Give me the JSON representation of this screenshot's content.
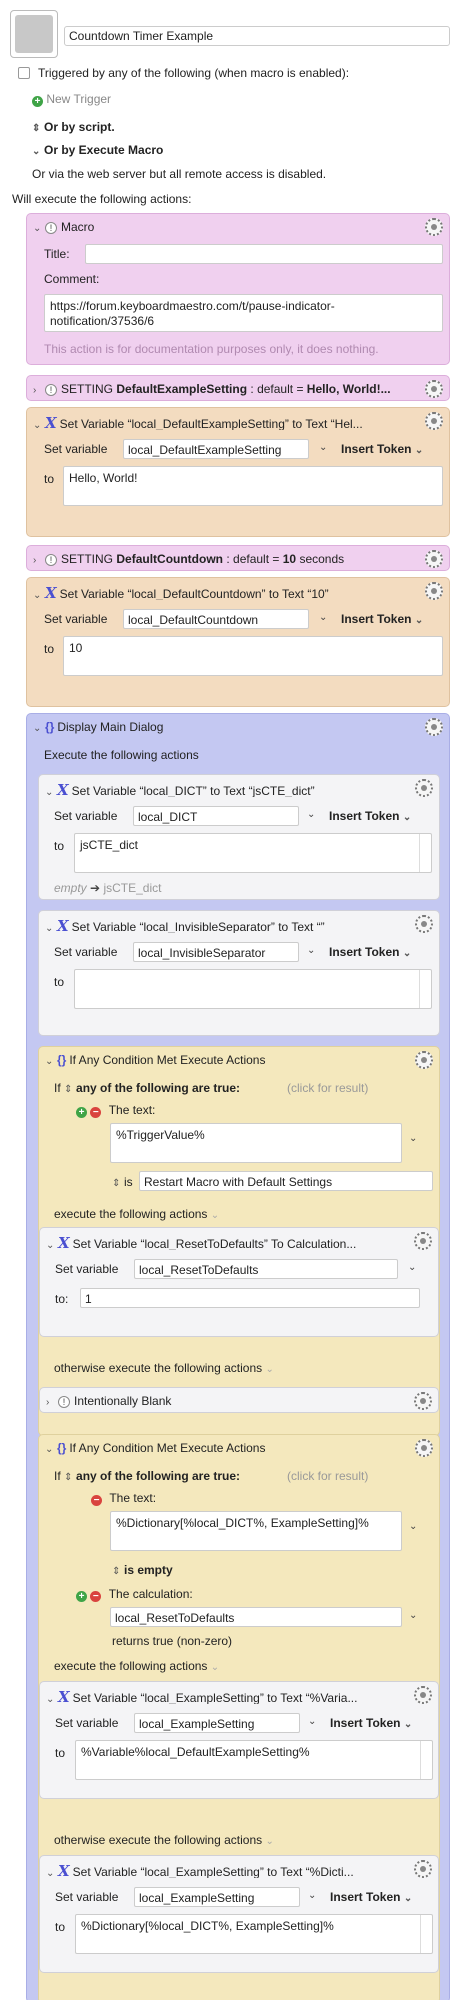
{
  "macro": {
    "name": "Countdown Timer Example",
    "trigger_text": "Triggered by any of the following (when macro is enabled):",
    "new_trigger": "New Trigger",
    "by_script": "Or by script.",
    "by_execute": "Or by Execute Macro",
    "web_server": "Or via the web server but all remote access is disabled.",
    "will_execute": "Will execute the following actions:"
  },
  "comment_action": {
    "title": "Macro",
    "title_label": "Title:",
    "comment_label": "Comment:",
    "comment_text": "https://forum.keyboardmaestro.com/t/pause-indicator-notification/37536/6",
    "note": "This action is for documentation purposes only, it does nothing."
  },
  "setting1": {
    "prefix": "SETTING",
    "name": "DefaultExampleSetting",
    "mid": ": default =",
    "value": "Hello, World!",
    "suffix": "..."
  },
  "setvar1": {
    "title": "Set Variable “local_DefaultExampleSetting” to Text “Hel...",
    "set_label": "Set variable",
    "var_name": "local_DefaultExampleSetting",
    "insert_token": "Insert Token",
    "to_label": "to",
    "text": "Hello, World!"
  },
  "setting2": {
    "prefix": "SETTING",
    "name": "DefaultCountdown",
    "mid": ": default =",
    "value": "10",
    "suffix": "seconds"
  },
  "setvar2": {
    "title": "Set Variable “local_DefaultCountdown” to Text “10”",
    "set_label": "Set variable",
    "var_name": "local_DefaultCountdown",
    "insert_token": "Insert Token",
    "to_label": "to",
    "text": "10"
  },
  "group": {
    "title": "Display Main Dialog",
    "execute_label": "Execute the following actions"
  },
  "gsv1": {
    "title": "Set Variable “local_DICT” to Text “jsCTE_dict”",
    "set_label": "Set variable",
    "var_name": "local_DICT",
    "insert_token": "Insert Token",
    "to_label": "to",
    "text": "jsCTE_dict",
    "empty_label": "empty",
    "empty_arrow": "➔",
    "empty_value": "jsCTE_dict"
  },
  "gsv2": {
    "title": "Set Variable “local_InvisibleSeparator” to Text “”",
    "set_label": "Set variable",
    "var_name": "local_InvisibleSeparator",
    "insert_token": "Insert Token",
    "to_label": "to",
    "text": ""
  },
  "if1": {
    "title": "If Any Condition Met Execute Actions",
    "if_label": "If",
    "any_label": "any of the following are true:",
    "click_result": "(click for result)",
    "cond_label": "The text:",
    "cond_text": "%TriggerValue%",
    "is_label": "is",
    "is_value": "Restart Macro with Default Settings",
    "execute_label": "execute the following actions",
    "otherwise_label": "otherwise execute the following actions"
  },
  "calc_action": {
    "title": "Set Variable “local_ResetToDefaults” To Calculation...",
    "set_label": "Set variable",
    "var_name": "local_ResetToDefaults",
    "to_label": "to:",
    "value": "1"
  },
  "blank_action": {
    "title": "Intentionally Blank"
  },
  "if2": {
    "title": "If Any Condition Met Execute Actions",
    "if_label": "If",
    "any_label": "any of the following are true:",
    "click_result": "(click for result)",
    "cond1_label": "The text:",
    "cond1_text": "%Dictionary[%local_DICT%, ExampleSetting]%",
    "cond1_is": "is empty",
    "cond2_label": "The calculation:",
    "cond2_text": "local_ResetToDefaults",
    "cond2_result": "returns true (non-zero)",
    "execute_label": "execute the following actions",
    "otherwise_label": "otherwise execute the following actions"
  },
  "if2sv1": {
    "title": "Set Variable “local_ExampleSetting” to Text “%Varia...",
    "set_label": "Set variable",
    "var_name": "local_ExampleSetting",
    "insert_token": "Insert Token",
    "to_label": "to",
    "text": "%Variable%local_DefaultExampleSetting%"
  },
  "if2sv2": {
    "title": "Set Variable “local_ExampleSetting” to Text “%Dicti...",
    "set_label": "Set variable",
    "var_name": "local_ExampleSetting",
    "insert_token": "Insert Token",
    "to_label": "to",
    "text": "%Dictionary[%local_DICT%, ExampleSetting]%"
  }
}
